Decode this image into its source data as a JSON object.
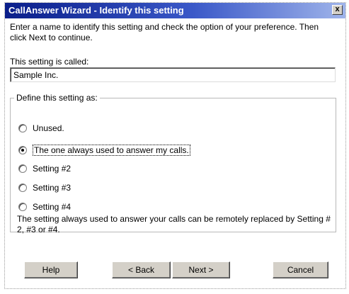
{
  "window": {
    "title": "CallAnswer Wizard - Identify this setting",
    "close_glyph": "x"
  },
  "intro_text": "Enter a name to identify this setting and check the option of your preference. Then click Next to continue.",
  "name_field": {
    "label": "This setting is called:",
    "value": "Sample Inc."
  },
  "group": {
    "legend": "Define this setting as:",
    "options": [
      {
        "label": "Unused.",
        "checked": false
      },
      {
        "label": "The one always used to answer my calls.",
        "checked": true
      },
      {
        "label": "Setting #2",
        "checked": false
      },
      {
        "label": "Setting #3",
        "checked": false
      },
      {
        "label": "Setting #4",
        "checked": false
      }
    ],
    "note": "The setting always used to answer your calls can be remotely replaced by  Setting # 2, #3 or #4."
  },
  "buttons": {
    "help": "Help",
    "back": "< Back",
    "next": "Next >",
    "cancel": "Cancel"
  }
}
